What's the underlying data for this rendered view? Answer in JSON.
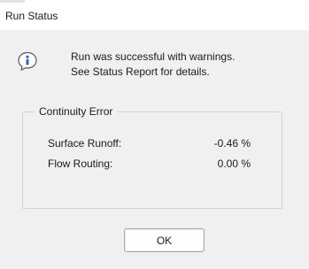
{
  "window": {
    "title": "Run Status"
  },
  "icon": {
    "name": "info-icon",
    "glyph": "i",
    "fill": "#2f5fb5"
  },
  "message": {
    "line1": "Run was successful with warnings.",
    "line2": "See Status Report for details."
  },
  "continuity": {
    "title": "Continuity Error",
    "rows": [
      {
        "label": "Surface Runoff:",
        "value": "-0.46 %"
      },
      {
        "label": "Flow Routing:",
        "value": "0.00 %"
      }
    ]
  },
  "buttons": {
    "ok_label": "OK"
  }
}
